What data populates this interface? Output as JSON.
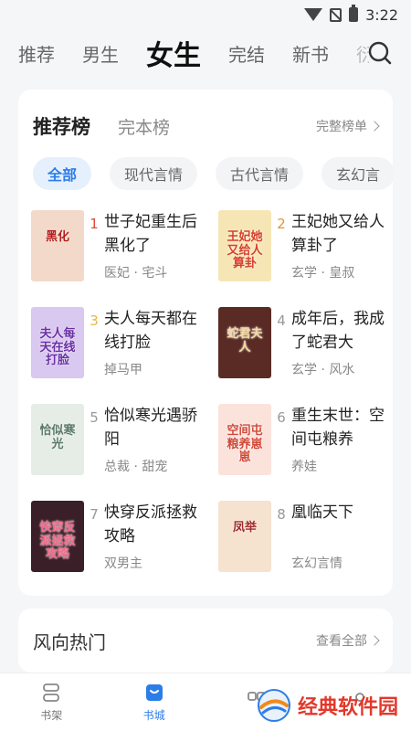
{
  "status": {
    "time": "3:22"
  },
  "top_nav": {
    "tabs": [
      "推荐",
      "男生",
      "女生",
      "完结",
      "新书"
    ],
    "active_tab": "女生",
    "faded_tab": "衍"
  },
  "rank_card": {
    "title": "推荐榜",
    "subtitle": "完本榜",
    "more_label": "完整榜单",
    "chips": [
      "全部",
      "现代言情",
      "古代言情",
      "玄幻言"
    ],
    "active_chip": "全部",
    "books": [
      {
        "rank": "1",
        "rank_color": "#e0483a",
        "name": "世子妃重生后黑化了",
        "tags": "医妃 · 宅斗",
        "cover_text": "黑化",
        "cover_bg": "#f3d9c9",
        "cover_fg": "#b31d1d"
      },
      {
        "rank": "2",
        "rank_color": "#e8922e",
        "name": "王妃她又给人算卦了",
        "tags": "玄学 · 皇叔",
        "cover_text": "王妃她又给人算卦",
        "cover_bg": "#f7e6b5",
        "cover_fg": "#d6402b"
      },
      {
        "rank": "3",
        "rank_color": "#e9b640",
        "name": "夫人每天都在线打脸",
        "tags": "掉马甲",
        "cover_text": "夫人每天在线打脸",
        "cover_bg": "#d9c8ef",
        "cover_fg": "#6a2fa5"
      },
      {
        "rank": "4",
        "rank_color": "#999999",
        "name": "成年后，我成了蛇君大",
        "tags": "玄学 · 风水",
        "cover_text": "蛇君夫人",
        "cover_bg": "#5a2b25",
        "cover_fg": "#f5d9a0"
      },
      {
        "rank": "5",
        "rank_color": "#999999",
        "name": "恰似寒光遇骄阳",
        "tags": "总裁 · 甜宠",
        "cover_text": "恰似寒光",
        "cover_bg": "#e6ece6",
        "cover_fg": "#5a7a6a"
      },
      {
        "rank": "6",
        "rank_color": "#999999",
        "name": "重生末世：空间屯粮养",
        "tags": "养娃",
        "cover_text": "空间屯粮养崽崽",
        "cover_bg": "#fbe3dc",
        "cover_fg": "#d04a3a"
      },
      {
        "rank": "7",
        "rank_color": "#999999",
        "name": "快穿反派拯救攻略",
        "tags": "双男主",
        "cover_text": "快穿反派拯救攻略",
        "cover_bg": "#3a1f28",
        "cover_fg": "#f26a8a"
      },
      {
        "rank": "8",
        "rank_color": "#999999",
        "name": "凰临天下",
        "tags": "玄幻言情",
        "cover_text": "凤举",
        "cover_bg": "#f6e3cf",
        "cover_fg": "#a12b2b"
      }
    ]
  },
  "trend_card": {
    "title": "风向热门",
    "more_label": "查看全部"
  },
  "bottom_bar": {
    "items": [
      {
        "label": "书架",
        "icon": "bookshelf-icon"
      },
      {
        "label": "书城",
        "icon": "bookstore-icon"
      },
      {
        "label": "",
        "icon": "category-icon"
      },
      {
        "label": "",
        "icon": "profile-icon"
      }
    ],
    "active": "书城"
  },
  "watermark": {
    "text": "经典软件园"
  },
  "colors": {
    "accent": "#2d7de8",
    "watermark": "#e2382b"
  }
}
